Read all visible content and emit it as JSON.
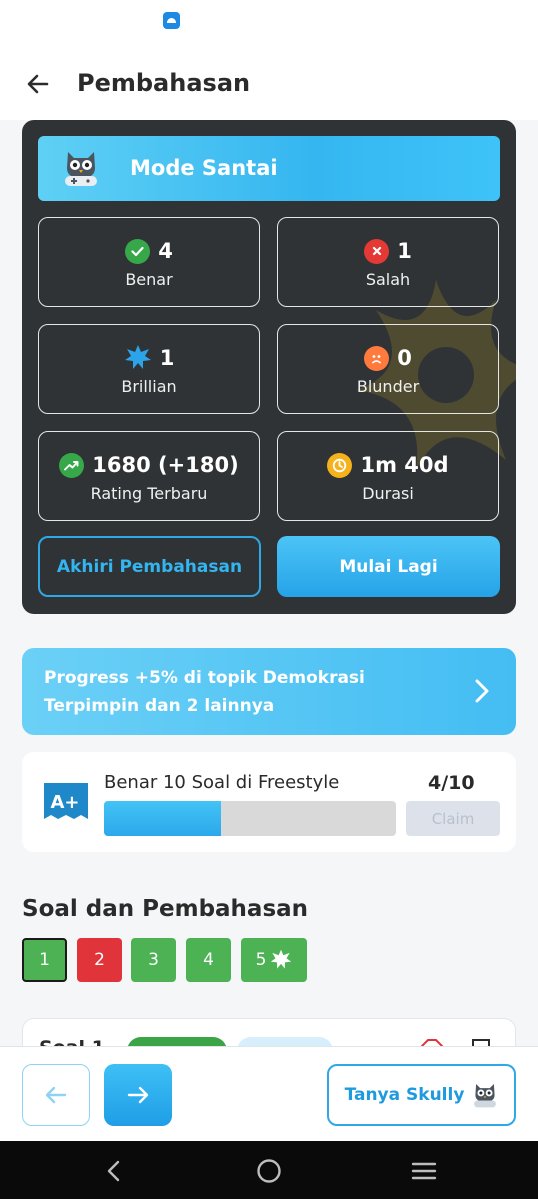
{
  "appbar": {
    "title": "Pembahasan"
  },
  "result": {
    "mode_title": "Mode Santai",
    "stats": [
      {
        "value": "4",
        "label": "Benar",
        "icon": "check-icon",
        "color": "#37a84a"
      },
      {
        "value": "1",
        "label": "Salah",
        "icon": "x-icon",
        "color": "#e53935"
      },
      {
        "value": "1",
        "label": "Brillian",
        "icon": "star-burst-icon",
        "color": "#2da3ea"
      },
      {
        "value": "0",
        "label": "Blunder",
        "icon": "sad-face-icon",
        "color": "#ff7a3c"
      },
      {
        "value": "1680 (+180)",
        "label": "Rating Terbaru",
        "icon": "trend-up-icon",
        "color": "#37a84a"
      },
      {
        "value": "1m 40d",
        "label": "Durasi",
        "icon": "clock-icon",
        "color": "#f5b21a"
      }
    ],
    "end_button": "Akhiri Pembahasan",
    "restart_button": "Mulai Lagi"
  },
  "progress_banner": {
    "text": "Progress +5% di topik Demokrasi Terpimpin dan 2 lainnya"
  },
  "quest": {
    "title": "Benar 10 Soal di Freestyle",
    "count": "4/10",
    "progress": 0.4,
    "claim_label": "Claim",
    "icon_text": "A+"
  },
  "questions": {
    "section_title": "Soal dan Pembahasan",
    "items": [
      {
        "label": "1",
        "status": "correct",
        "selected": true
      },
      {
        "label": "2",
        "status": "wrong",
        "selected": false
      },
      {
        "label": "3",
        "status": "correct",
        "selected": false
      },
      {
        "label": "4",
        "status": "correct",
        "selected": false
      },
      {
        "label": "5",
        "status": "correct",
        "selected": false,
        "brilliant": true
      }
    ]
  },
  "soal_card": {
    "label": "Soal 1"
  },
  "bottom": {
    "ask_label": "Tanya Skully"
  },
  "colors": {
    "accent": "#33b5f0",
    "dark_card": "#2f3335",
    "correct": "#4cb254",
    "wrong": "#e0343a"
  }
}
